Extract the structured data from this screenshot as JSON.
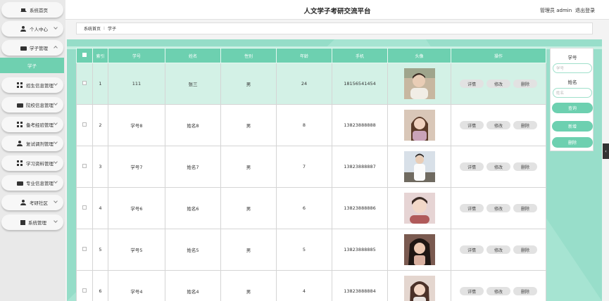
{
  "header": {
    "title": "人文学子考研交流平台",
    "role": "管理员 admin",
    "logout": "退出登录"
  },
  "sidebar": {
    "items": [
      {
        "label": "系统首页",
        "icon": "home-icon"
      },
      {
        "label": "个人中心",
        "icon": "user-icon"
      },
      {
        "label": "学子管理",
        "icon": "id-card-icon"
      },
      {
        "label": "招生信息管理",
        "icon": "grid-icon"
      },
      {
        "label": "院校信息管理",
        "icon": "id-card-icon"
      },
      {
        "label": "备考经验管理",
        "icon": "grid-icon"
      },
      {
        "label": "复试调剂管理",
        "icon": "user-icon"
      },
      {
        "label": "学习资料管理",
        "icon": "grid-icon"
      },
      {
        "label": "专业信息管理",
        "icon": "id-card-icon"
      },
      {
        "label": "考研社区",
        "icon": "user-icon"
      },
      {
        "label": "系统管理",
        "icon": "book-icon"
      }
    ],
    "active_sub": "学子"
  },
  "breadcrumb": {
    "home": "系统首页",
    "sep": "⁝",
    "current": "学子"
  },
  "table": {
    "headers": [
      "索引",
      "学号",
      "姓名",
      "性别",
      "年龄",
      "手机",
      "头像",
      "操作"
    ],
    "rows": [
      {
        "idx": "1",
        "sid": "111",
        "name": "张三",
        "gender": "男",
        "age": "24",
        "phone": "18156541454"
      },
      {
        "idx": "2",
        "sid": "学号8",
        "name": "姓名8",
        "gender": "男",
        "age": "8",
        "phone": "13823888888"
      },
      {
        "idx": "3",
        "sid": "学号7",
        "name": "姓名7",
        "gender": "男",
        "age": "7",
        "phone": "13823888887"
      },
      {
        "idx": "4",
        "sid": "学号6",
        "name": "姓名6",
        "gender": "男",
        "age": "6",
        "phone": "13823888886"
      },
      {
        "idx": "5",
        "sid": "学号5",
        "name": "姓名5",
        "gender": "男",
        "age": "5",
        "phone": "13823888885"
      },
      {
        "idx": "6",
        "sid": "学号4",
        "name": "姓名4",
        "gender": "男",
        "age": "4",
        "phone": "13823888884"
      }
    ],
    "actions": {
      "detail": "详情",
      "edit": "修改",
      "delete": "删除"
    }
  },
  "search": {
    "sid_label": "学号",
    "sid_placeholder": "学号",
    "name_label": "姓名",
    "name_placeholder": "姓名",
    "query_btn": "查询",
    "add_btn": "新增",
    "delete_btn": "删除"
  },
  "colors": {
    "accent": "#6dd0b0",
    "panel": "#a6e4d2",
    "highlight": "#d3f1e6"
  }
}
